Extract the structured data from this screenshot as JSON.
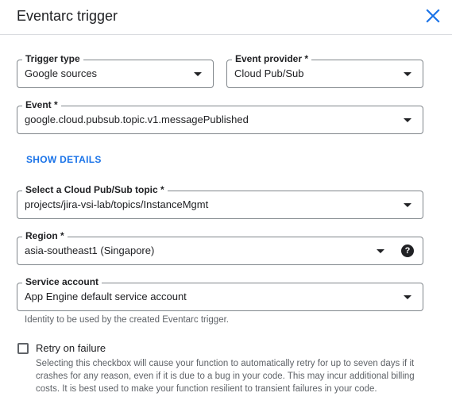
{
  "header": {
    "title": "Eventarc trigger",
    "close_icon": "close-icon",
    "close_color": "#1a73e8"
  },
  "fields": {
    "trigger_type": {
      "label": "Trigger type",
      "value": "Google sources"
    },
    "event_provider": {
      "label": "Event provider *",
      "value": "Cloud Pub/Sub"
    },
    "event": {
      "label": "Event *",
      "value": "google.cloud.pubsub.topic.v1.messagePublished"
    },
    "topic": {
      "label": "Select a Cloud Pub/Sub topic *",
      "value": "projects/jira-vsi-lab/topics/InstanceMgmt"
    },
    "region": {
      "label": "Region *",
      "value": "asia-southeast1 (Singapore)",
      "help_icon": "help-icon"
    },
    "service_account": {
      "label": "Service account",
      "value": "App Engine default service account",
      "hint": "Identity to be used by the created Eventarc trigger."
    }
  },
  "show_details_label": "SHOW DETAILS",
  "retry": {
    "label": "Retry on failure",
    "checked": false,
    "description": "Selecting this checkbox will cause your function to automatically retry for up to seven days if it crashes for any reason, even if it is due to a bug in your code. This may incur additional billing costs. It is best used to make your function resilient to transient failures in your code."
  },
  "colors": {
    "accent": "#1a73e8",
    "text": "#202124",
    "secondary_text": "#5f6368",
    "border": "#80868b"
  }
}
